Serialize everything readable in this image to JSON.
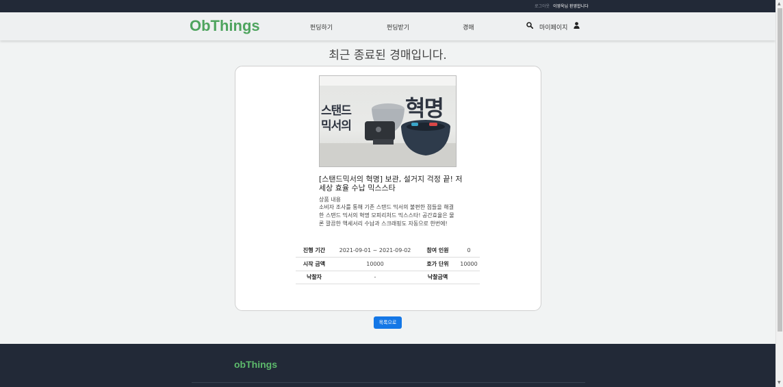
{
  "topbar": {
    "logout": "로그아웃",
    "welcome": "이영욱님 환영합니다"
  },
  "header": {
    "logo": "ObThings",
    "nav": [
      "펀딩하기",
      "펀딩받기",
      "경매"
    ],
    "mypage": "마이페이지",
    "icons": {
      "search": "search-icon",
      "user": "user-icon"
    }
  },
  "main": {
    "title": "최근 종료된 경매입니다.",
    "image": {
      "text_left_1": "스탠드",
      "text_left_2": "믹서의",
      "text_right": "혁명"
    },
    "product_title": "[스탠드믹서의 혁명] 보관, 설거지 걱정 끝! 저세상 효율 수납 믹스스타",
    "description_label": "상품 내용",
    "description": "소비자 조사를 통해 기존 스탠드 믹서의 불편한 점들을 해결한 스탠드 믹서의 혁명 모피리처드 믹스스타! 공간효율은 물론 깔끔한 액세서리 수납과 스크래핑도 자동으로 한번에!",
    "table": [
      [
        "진행 기간",
        "2021-09-01 ~ 2021-09-02",
        "참여 인원",
        "0"
      ],
      [
        "시작 금액",
        "10000",
        "호가 단위",
        "10000"
      ],
      [
        "낙찰자",
        "-",
        "낙찰금액",
        ""
      ]
    ],
    "list_button": "목록으로"
  },
  "footer": {
    "brand": "obThings"
  },
  "colors": {
    "accent": "#4ea45e",
    "dark": "#222937",
    "button": "#1477e6"
  }
}
